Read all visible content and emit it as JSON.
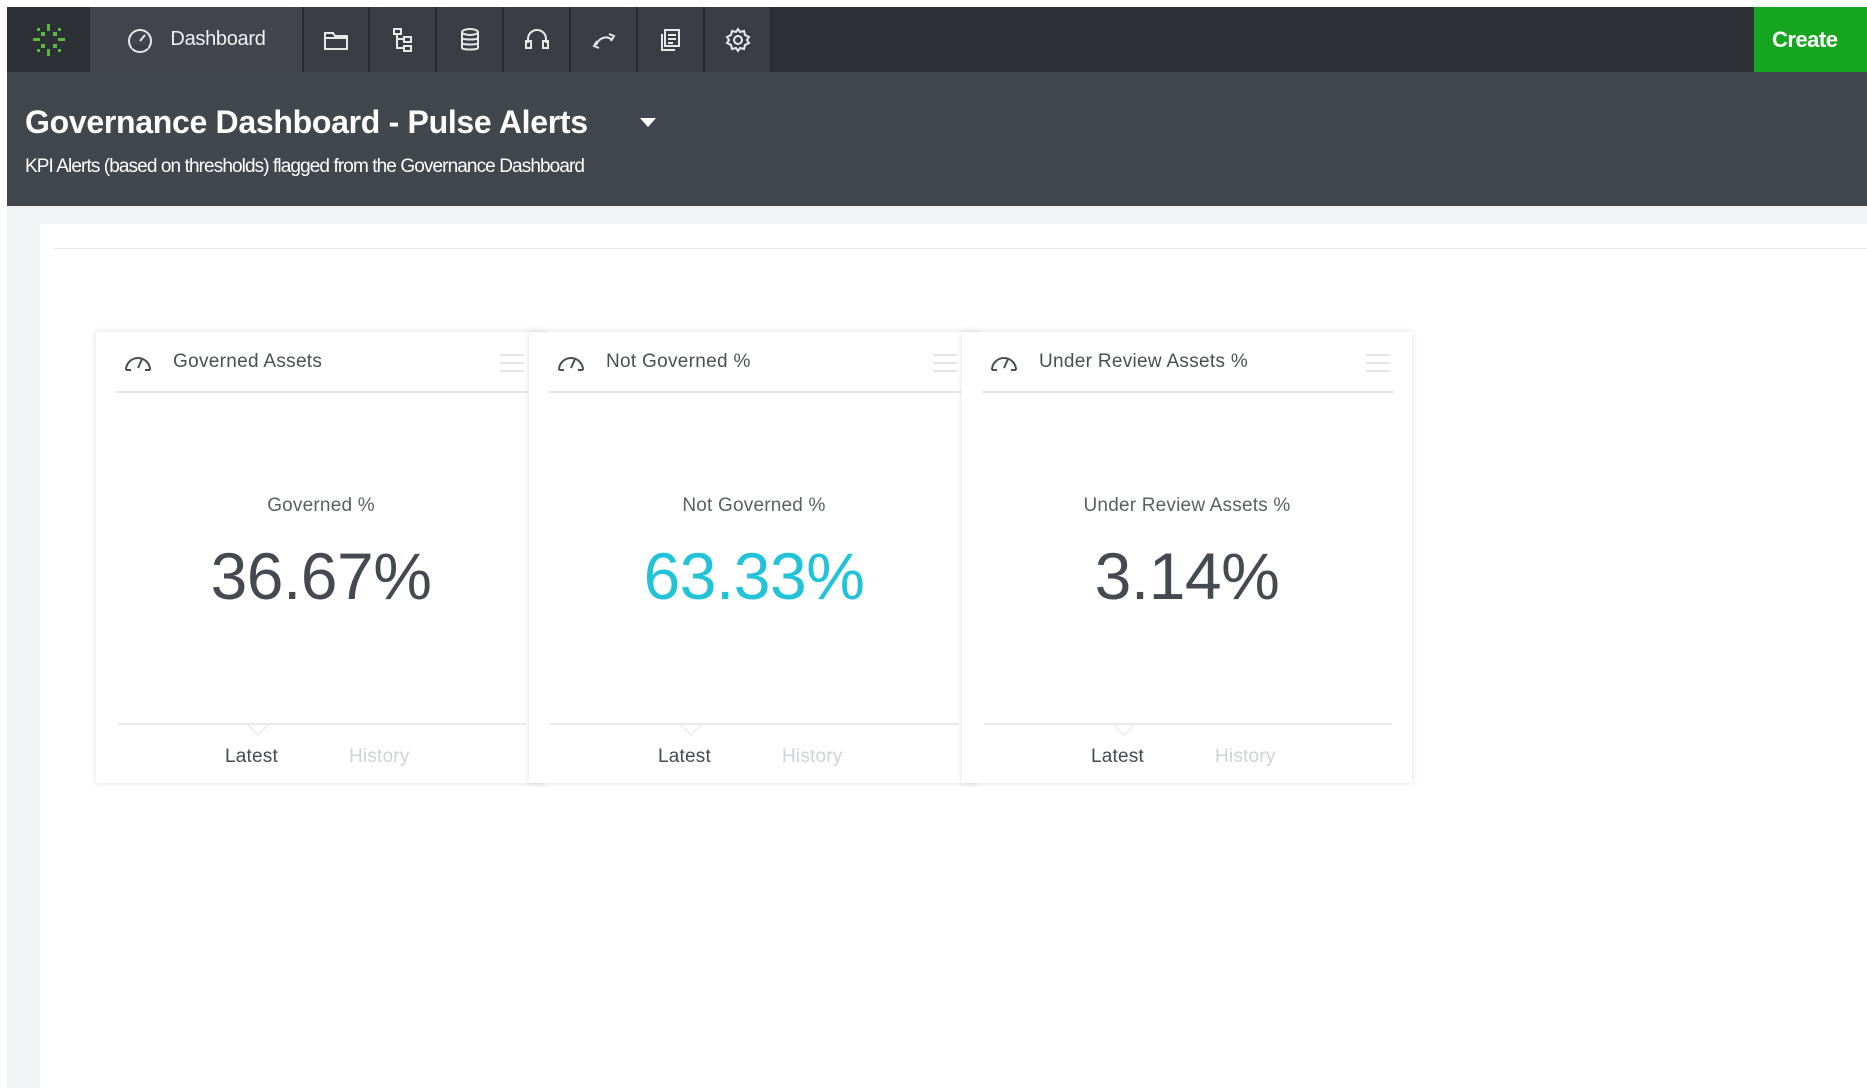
{
  "nav": {
    "dashboard_label": "Dashboard",
    "create_label": "Create",
    "icons": [
      "logo-icon",
      "dashboard-gauge-icon",
      "folder-icon",
      "hierarchy-icon",
      "database-icon",
      "headset-icon",
      "transfer-icon",
      "reports-icon",
      "settings-icon"
    ]
  },
  "header": {
    "title": "Governance Dashboard - Pulse Alerts",
    "subtitle": "KPI Alerts (based on thresholds) flagged from the Governance Dashboard"
  },
  "cards": [
    {
      "title": "Governed Assets",
      "metric_label": "Governed %",
      "value": "36.67%",
      "tab_latest": "Latest",
      "tab_history": "History"
    },
    {
      "title": "Not Governed %",
      "metric_label": "Not Governed %",
      "value": "63.33%",
      "tab_latest": "Latest",
      "tab_history": "History"
    },
    {
      "title": "Under Review Assets %",
      "metric_label": "Under Review Assets %",
      "value": "3.14%",
      "tab_latest": "Latest",
      "tab_history": "History"
    }
  ],
  "colors": {
    "nav_bg": "#2d3035",
    "header_bg": "#42474d",
    "create_green": "#16a51e",
    "accent_cyan": "#22c3d8",
    "value_gray": "#454a52"
  }
}
